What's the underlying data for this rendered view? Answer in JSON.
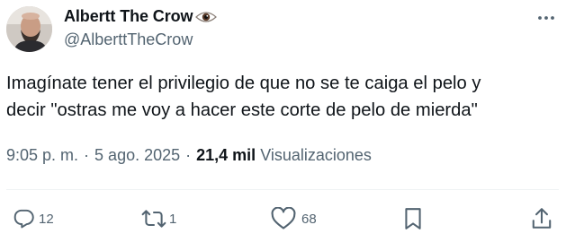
{
  "author": {
    "display_name": "Albertt The Crow",
    "name_emoji_icon": "eye-icon",
    "handle": "@AlberttTheCrow",
    "avatar_icon": "avatar-man-beard"
  },
  "tweet": {
    "lines": [
      "Imagínate tener el privilegio de que no se te caiga el pelo y",
      "decir \"ostras me voy a hacer este corte de pelo de mierda\""
    ]
  },
  "meta": {
    "time": "9:05 p. m.",
    "separator": "·",
    "date": "5 ago. 2025",
    "views_count": "21,4 mil",
    "views_label": "Visualizaciones"
  },
  "actions": {
    "reply": {
      "icon": "reply-icon",
      "count": "12"
    },
    "retweet": {
      "icon": "retweet-icon",
      "count": "1"
    },
    "like": {
      "icon": "heart-icon",
      "count": "68"
    },
    "bookmark": {
      "icon": "bookmark-icon"
    },
    "share": {
      "icon": "share-icon"
    }
  },
  "colors": {
    "text_primary": "#0f1419",
    "text_secondary": "#536471",
    "divider": "#eff3f4",
    "background": "#ffffff"
  }
}
